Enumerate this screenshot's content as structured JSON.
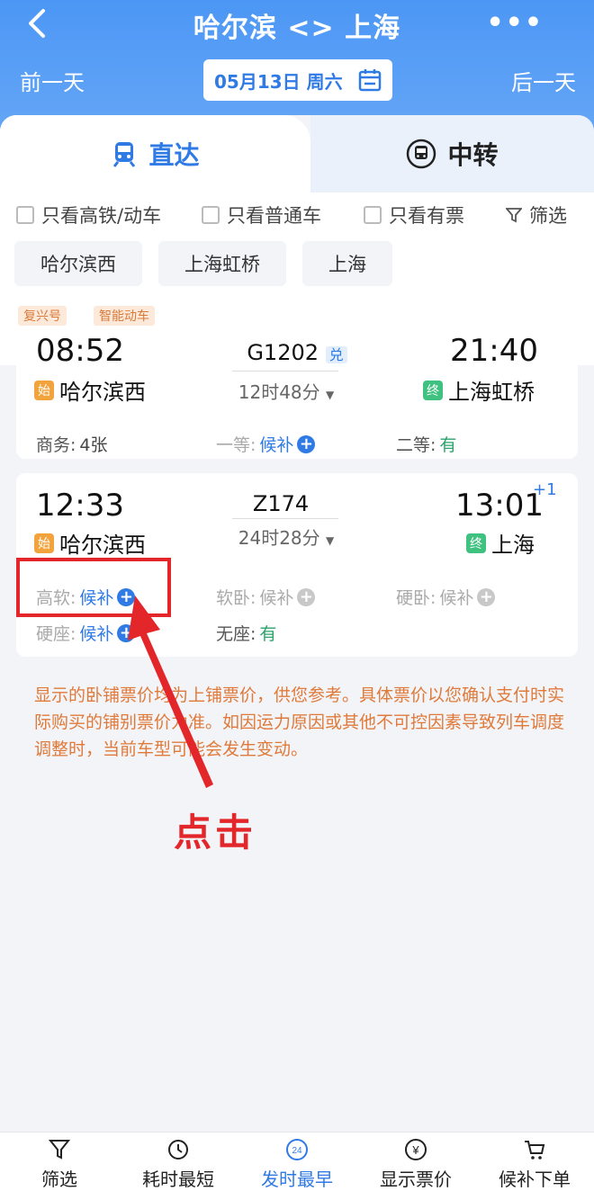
{
  "header": {
    "title": "哈尔滨 <> 上海",
    "prev_day": "前一天",
    "next_day": "后一天",
    "date": "05月13日 周六"
  },
  "tabs": [
    {
      "label": "直达"
    },
    {
      "label": "中转"
    }
  ],
  "filters": {
    "only_highspeed": "只看高铁/动车",
    "only_normal": "只看普通车",
    "only_available": "只看有票",
    "filter": "筛选"
  },
  "stations": [
    "哈尔滨西",
    "上海虹桥",
    "上海"
  ],
  "trains": [
    {
      "tags": [
        "复兴号",
        "智能动车"
      ],
      "depart_time": "08:52",
      "depart_station": "哈尔滨西",
      "number": "G1202",
      "badge": "兑",
      "duration": "12时48分",
      "arrive_time": "21:40",
      "arrive_station": "上海虹桥",
      "seats": [
        {
          "label": "商务:",
          "value": "4张"
        },
        {
          "label": "一等:",
          "value": "候补"
        },
        {
          "label": "二等:",
          "value": "有"
        }
      ]
    },
    {
      "depart_time": "12:33",
      "depart_station": "哈尔滨西",
      "number": "Z174",
      "duration": "24时28分",
      "arrive_time": "13:01",
      "arrive_plus": "+1",
      "arrive_station": "上海",
      "seats": [
        {
          "label": "高软:",
          "value": "候补"
        },
        {
          "label": "软卧:",
          "value": "候补"
        },
        {
          "label": "硬卧:",
          "value": "候补"
        },
        {
          "label": "硬座:",
          "value": "候补"
        },
        {
          "label": "无座:",
          "value": "有"
        }
      ]
    }
  ],
  "icon_labels": {
    "from": "始",
    "to": "终"
  },
  "note": "显示的卧铺票价均为上铺票价，供您参考。具体票价以您确认支付时实际购买的铺别票价为准。如因运力原因或其他不可控因素导致列车调度调整时，当前车型可能会发生变动。",
  "annotation": {
    "click_label": "点击"
  },
  "bottom_bar": [
    {
      "label": "筛选",
      "icon": "filter-icon"
    },
    {
      "label": "耗时最短",
      "icon": "timer-icon"
    },
    {
      "label": "发时最早",
      "icon": "clock-24-icon",
      "badge": "24"
    },
    {
      "label": "显示票价",
      "icon": "yen-icon",
      "glyph": "¥"
    },
    {
      "label": "候补下单",
      "icon": "cart-icon"
    }
  ],
  "colors": {
    "accent": "#2f7ae5",
    "header": "#4c97f5",
    "warning": "#e07a3a",
    "highlight": "#e3262a",
    "available": "#2ba36b"
  }
}
